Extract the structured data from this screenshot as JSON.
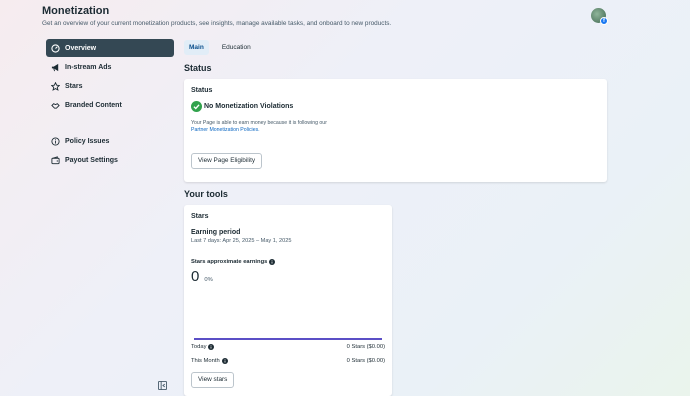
{
  "header": {
    "title": "Monetization",
    "subtitle": "Get an overview of your current monetization products, see insights, manage available tasks, and onboard to new products."
  },
  "sidebar": {
    "items": [
      {
        "label": "Overview",
        "icon": "overview-icon"
      },
      {
        "label": "In-stream Ads",
        "icon": "megaphone-icon"
      },
      {
        "label": "Stars",
        "icon": "star-icon"
      },
      {
        "label": "Branded Content",
        "icon": "handshake-icon"
      },
      {
        "label": "Policy Issues",
        "icon": "info-icon"
      },
      {
        "label": "Payout Settings",
        "icon": "wallet-icon"
      }
    ]
  },
  "tabs": [
    "Main",
    "Education"
  ],
  "status_section": {
    "heading": "Status",
    "card_title": "Status",
    "violation_label": "No Monetization Violations",
    "description_prefix": "Your Page is able to earn money because it is following our",
    "policy_link": "Partner Monetization Policies.",
    "button": "View Page Eligibility"
  },
  "tools_section": {
    "heading": "Your tools",
    "stars_card": {
      "title": "Stars",
      "earning_period_label": "Earning period",
      "earning_period_range": "Last 7 days: Apr 25, 2025 – May 1, 2025",
      "approx_earnings_label": "Stars approximate earnings",
      "earnings_value": "0",
      "earnings_change": "0%",
      "today_label": "Today",
      "today_value": "0 Stars ($0.00)",
      "month_label": "This Month",
      "month_value": "0 Stars ($0.00)",
      "button": "View stars"
    }
  },
  "colors": {
    "active_nav": "#344854",
    "success": "#31a24c",
    "chart_line": "#5b4fc6",
    "link": "#0a66c2"
  }
}
